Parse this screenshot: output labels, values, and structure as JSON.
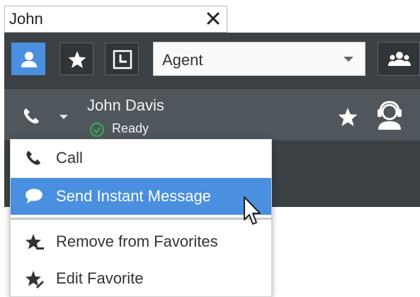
{
  "search": {
    "value": "John"
  },
  "toolbar": {
    "filter_value": "Agent"
  },
  "contact": {
    "name": "John Davis",
    "status": "Ready"
  },
  "menu": {
    "items": [
      {
        "label": "Call",
        "icon": "phone-icon"
      },
      {
        "label": "Send Instant Message",
        "icon": "chat-bubble-icon",
        "highlighted": true
      },
      {
        "label": "Remove from Favorites",
        "icon": "remove-favorite-icon"
      },
      {
        "label": "Edit Favorite",
        "icon": "edit-favorite-icon"
      }
    ]
  },
  "colors": {
    "accent": "#4a8fe0",
    "panel": "#3b4145",
    "row": "#4f575c",
    "ready": "#2fb64a"
  }
}
